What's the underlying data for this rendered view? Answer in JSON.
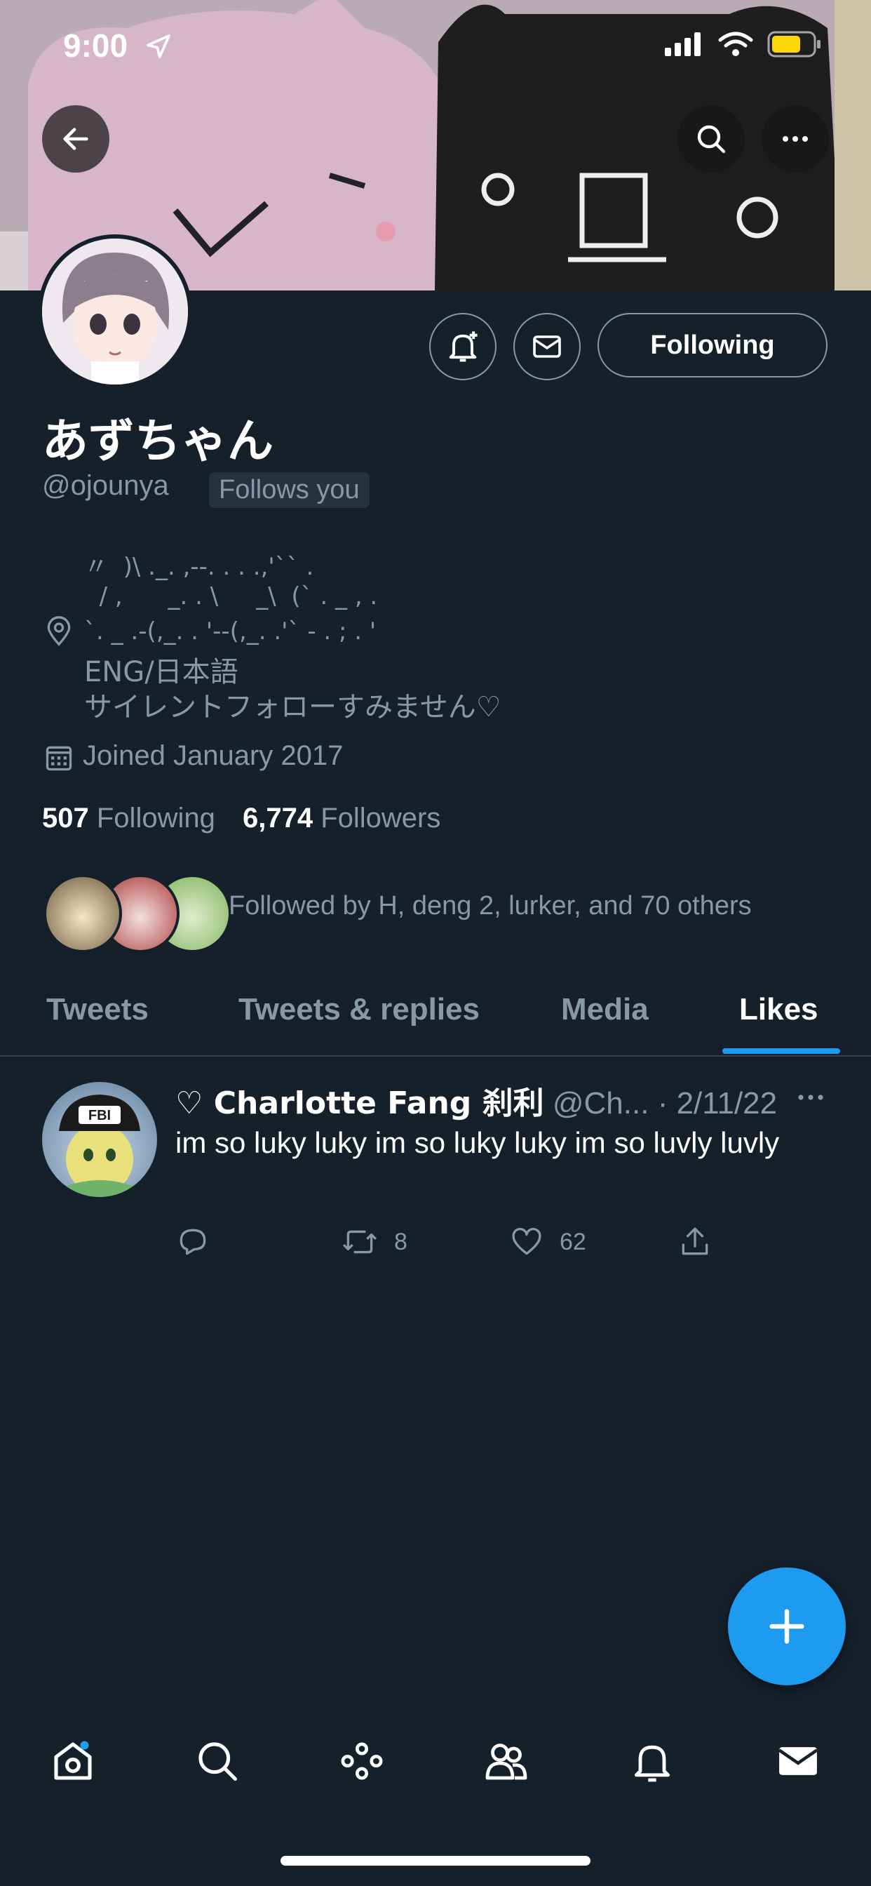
{
  "status_bar": {
    "time": "9:00"
  },
  "profile": {
    "display_name": "あずちゃん",
    "handle": "@ojounya",
    "follows_you": "Follows you",
    "follow_button": "Following",
    "bio_lines": [
      "〃  )\\ ._. ,--. . . .,'`` .",
      "  / ,      _. . \\     _\\  (` . _ , .",
      "`. _ .-(,_. . '--(,_. .'` - . ; . '",
      "ENG/日本語",
      "サイレントフォローすみません♡"
    ],
    "joined": "Joined January 2017",
    "following_count": "507",
    "following_label": "Following",
    "followers_count": "6,774",
    "followers_label": "Followers",
    "followed_by": "Followed by H, deng 2, lurker, and 70 others"
  },
  "tabs": [
    {
      "label": "Tweets",
      "active": false
    },
    {
      "label": "Tweets & replies",
      "active": false
    },
    {
      "label": "Media",
      "active": false
    },
    {
      "label": "Likes",
      "active": true
    }
  ],
  "tweet": {
    "author_name": "♡ Charlotte Fang 刹利",
    "author_handle": "@Ch...",
    "separator": "·",
    "date": "2/11/22",
    "text": "im so luky luky im so luky luky im so luvly luvly",
    "avatar_badge": "FBI",
    "retweets": "8",
    "likes": "62"
  },
  "colors": {
    "background": "#15202b",
    "accent": "#1d9bf0",
    "secondary_text": "#8899a6",
    "divider": "#38444d"
  },
  "icons": [
    "back-arrow-icon",
    "search-icon",
    "more-icon",
    "notification-bell-icon",
    "mail-icon",
    "location-icon",
    "calendar-icon",
    "reply-icon",
    "retweet-icon",
    "like-icon",
    "share-icon",
    "compose-plus-icon",
    "home-icon",
    "explore-icon",
    "spaces-icon",
    "communities-icon",
    "notifications-icon",
    "messages-icon"
  ]
}
